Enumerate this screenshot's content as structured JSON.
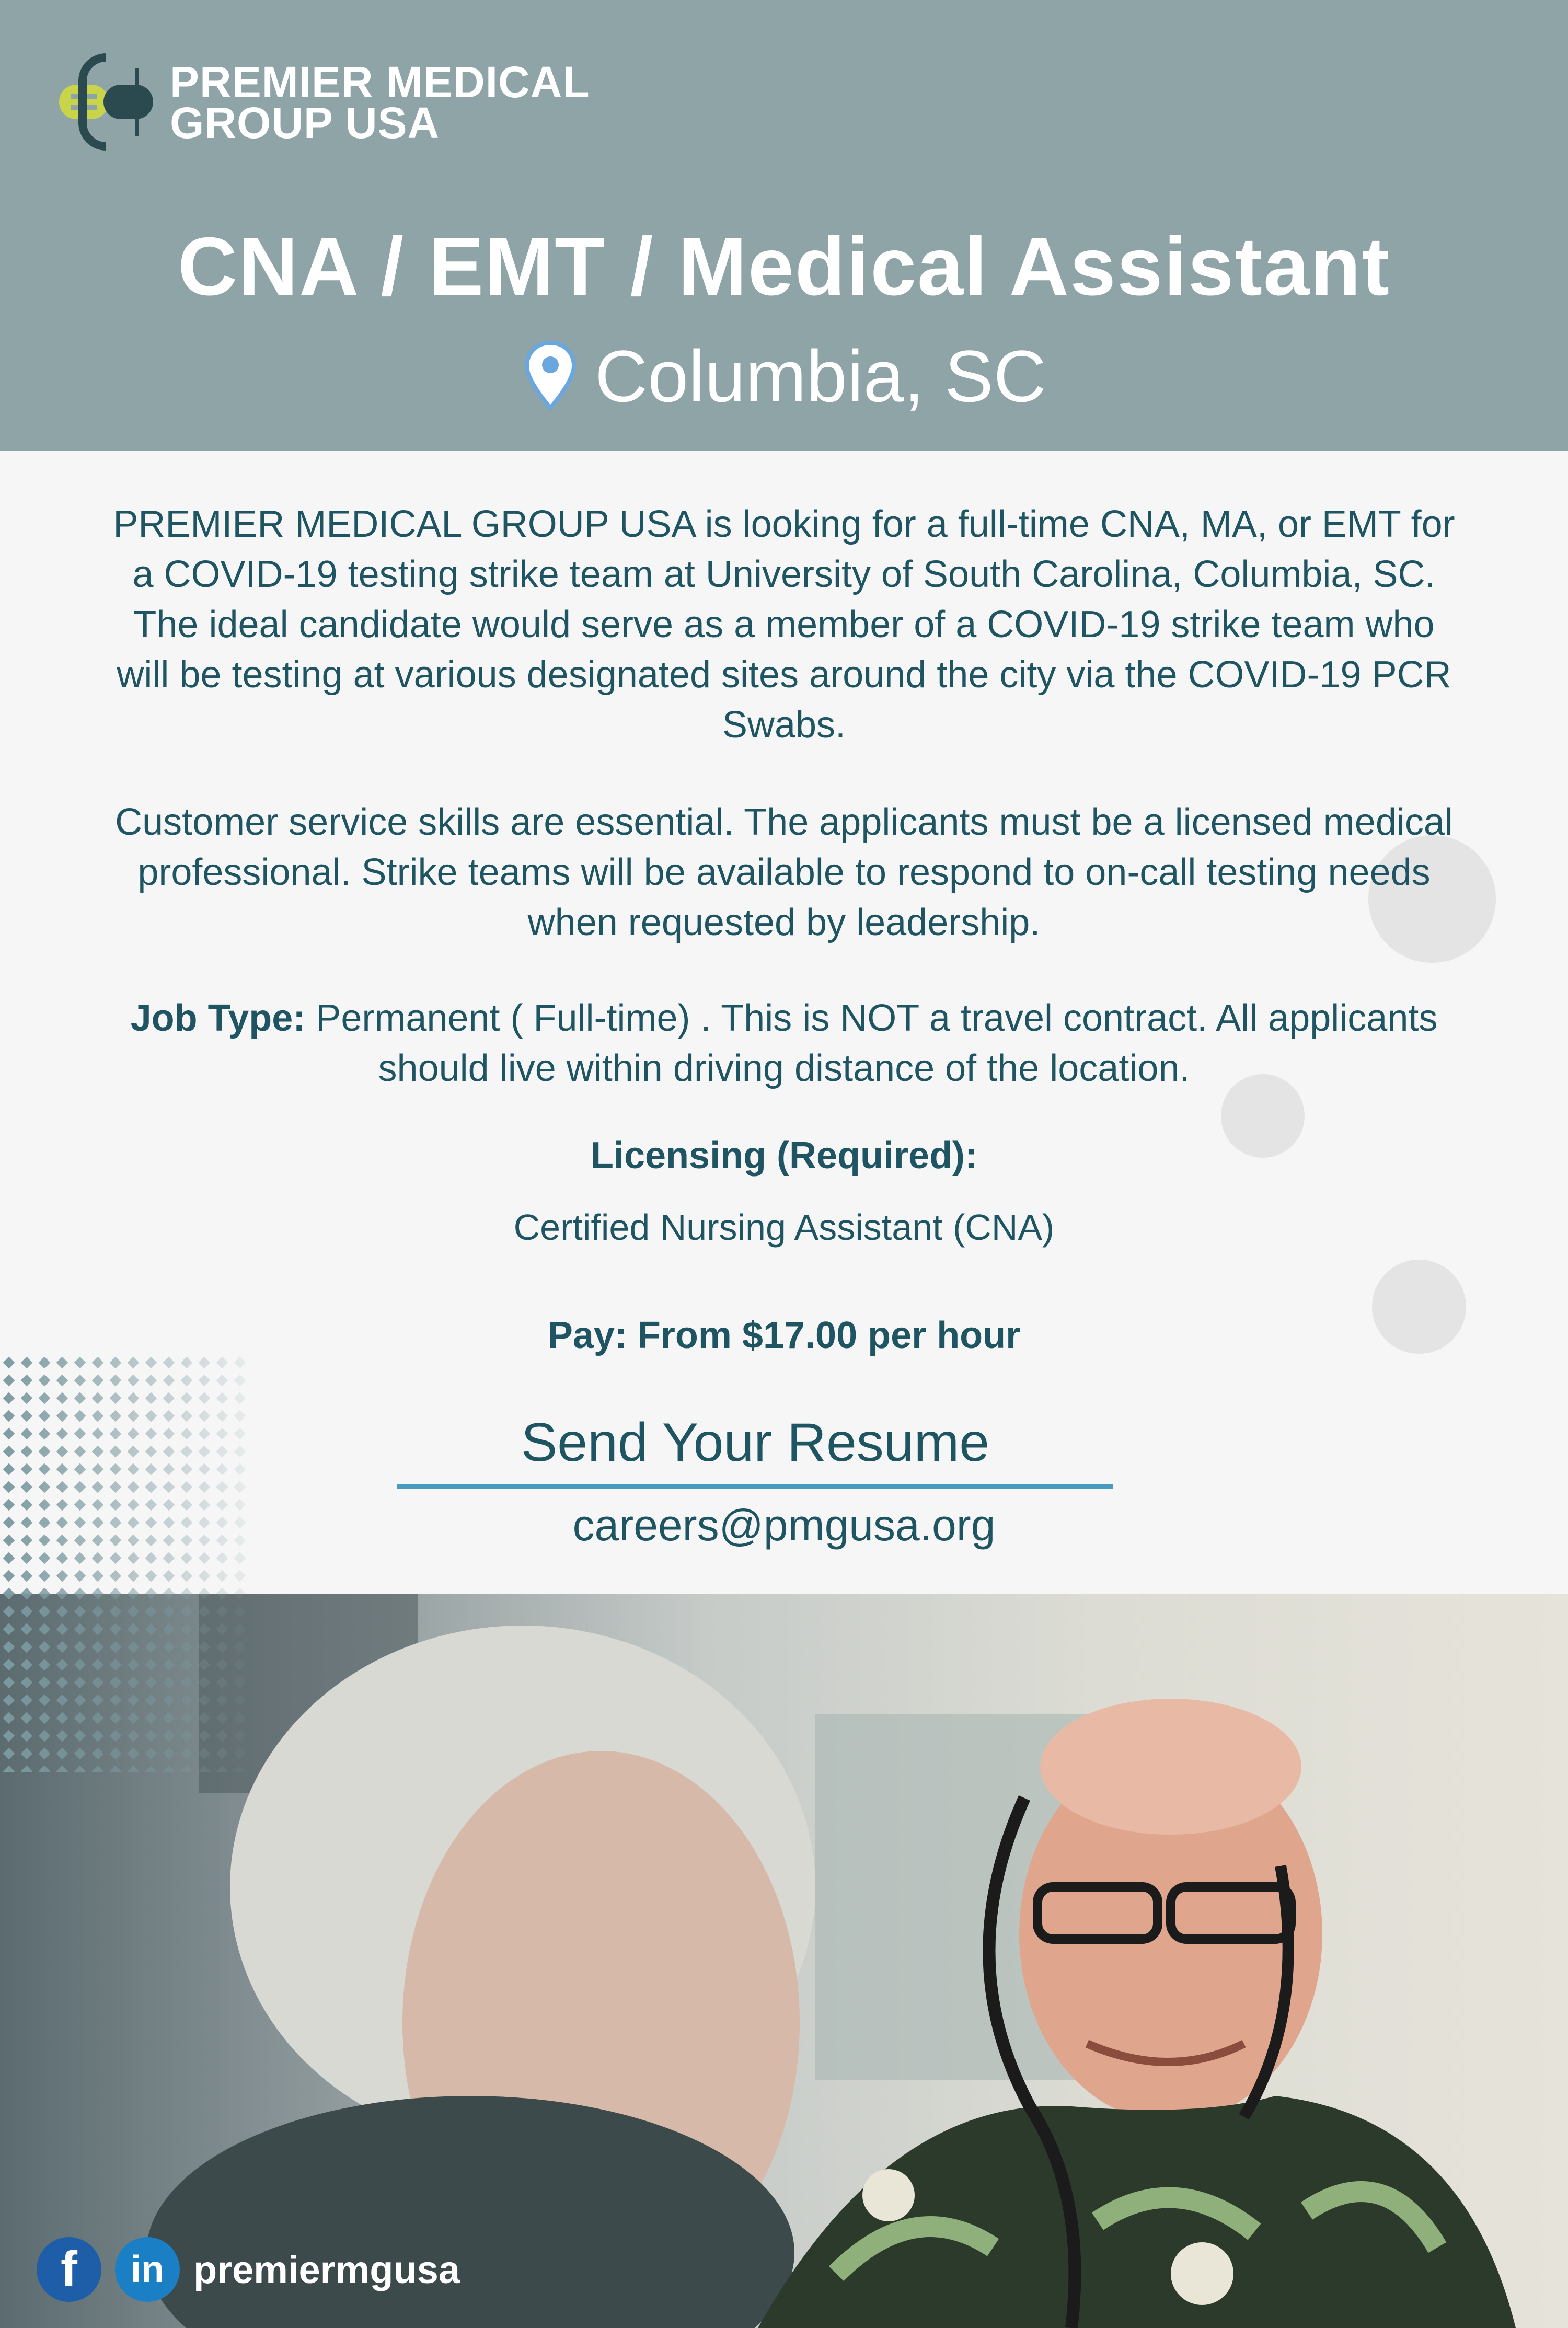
{
  "brand": {
    "line1": "PREMIER MEDICAL",
    "line2": "GROUP USA"
  },
  "job": {
    "title": "CNA / EMT / Medical Assistant",
    "location": "Columbia, SC",
    "location_icon": "map-pin-icon"
  },
  "description": {
    "paragraph1": "PREMIER MEDICAL GROUP USA is looking for a full-time CNA, MA, or EMT for a COVID-19 testing strike team at University of South Carolina, Columbia, SC. The ideal candidate would serve as a member of a COVID-19 strike team who will be testing at various designated sites around the city via the COVID-19 PCR Swabs.",
    "paragraph2": "Customer service skills are essential. The applicants must be a licensed medical professional. Strike teams will be available to respond to on-call testing needs when requested by leadership.",
    "job_type_label": "Job Type:",
    "job_type_text": "Permanent  ( Full-time) . This is NOT a travel contract. All applicants should live within driving distance of the location."
  },
  "licensing": {
    "heading": "Licensing (Required):",
    "value": "Certified Nursing Assistant (CNA)"
  },
  "pay": "Pay: From $17.00 per hour",
  "cta": {
    "label": "Send Your Resume",
    "email": "careers@pmgusa.org"
  },
  "social": {
    "facebook_icon": "facebook-icon",
    "linkedin_icon": "linkedin-icon",
    "facebook_glyph": "f",
    "linkedin_glyph": "in",
    "handle": "premiermgusa"
  },
  "colors": {
    "header_bg": "#8fa4a7",
    "text_primary": "#1f5562",
    "accent_line": "#4a9bbd",
    "logo_lime": "#c8d44a"
  }
}
